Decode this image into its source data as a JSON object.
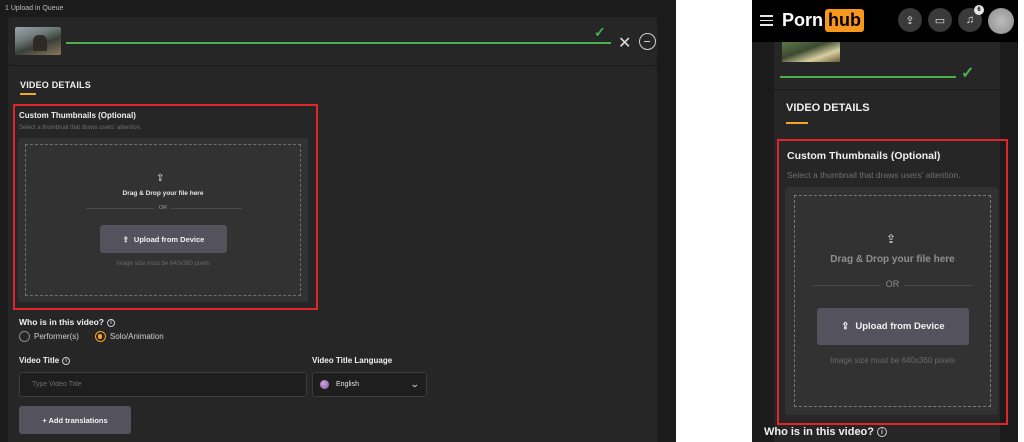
{
  "left_panel": {
    "queue_label": "1 Upload in Queue",
    "details_title": "VIDEO DETAILS",
    "custom_thumbnails": {
      "title": "Custom Thumbnails (Optional)",
      "subtitle": "Select a thumbnail that draws users' attention.",
      "drag_drop": "Drag & Drop your file here",
      "or": "OR",
      "upload_button": "Upload from Device",
      "image_size": "Image size must be 640x360 pixels"
    },
    "who_label": "Who is in this video?",
    "radio_options": [
      "Performer(s)",
      "Solo/Animation"
    ],
    "video_title_label": "Video Title",
    "video_title_placeholder": "Type Video Title",
    "video_title_language_label": "Video Title Language",
    "language_value": "English",
    "add_translations": "+ Add translations"
  },
  "right_panel": {
    "logo_part1": "Porn",
    "logo_part2": "hub",
    "notification_count": "6",
    "details_title": "VIDEO DETAILS",
    "custom_thumbnails": {
      "title": "Custom Thumbnails (Optional)",
      "subtitle": "Select a thumbnail that draws users' attention.",
      "drag_drop": "Drag & Drop your file here",
      "or": "OR",
      "upload_button": "Upload from Device",
      "image_size": "Image size must be 640x360 pixels"
    },
    "who_label": "Who is in this video?"
  },
  "colors": {
    "accent": "#f6a623",
    "highlight_border": "#e0262b",
    "success": "#4caf50",
    "logo_orange": "#f7971d"
  },
  "icons": {
    "check": "check-icon",
    "close": "close-icon",
    "remove": "minus-circle-icon",
    "upload": "upload-icon",
    "info": "info-icon",
    "globe": "globe-icon",
    "chevron": "chevron-down-icon",
    "menu": "hamburger-icon",
    "chat": "chat-icon",
    "bell": "bell-icon"
  }
}
